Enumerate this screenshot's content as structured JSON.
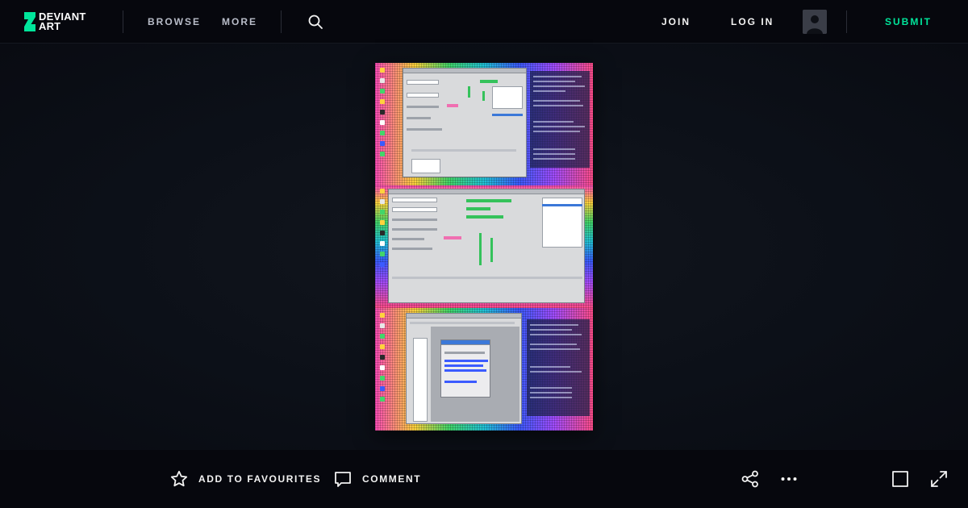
{
  "header": {
    "logo_text": "DEVIANT\nART",
    "nav": [
      {
        "label": "BROWSE"
      },
      {
        "label": "MORE"
      }
    ],
    "join_label": "JOIN",
    "login_label": "LOG IN",
    "submit_label": "SUBMIT",
    "search_icon": "search-icon",
    "avatar_icon": "user-avatar-icon"
  },
  "artwork": {
    "alt": "Desktop screenshot collage",
    "panels": 3
  },
  "actions": {
    "favourite_label": "ADD TO FAVOURITES",
    "comment_label": "COMMENT",
    "icons": [
      "star-icon",
      "comment-icon",
      "share-icon",
      "more-icon",
      "square-view-icon",
      "expand-icon"
    ]
  },
  "colors": {
    "background": "#06070d",
    "accent": "#00e59b",
    "text": "#f2f2f2",
    "nav_text": "#b8bcc8"
  }
}
